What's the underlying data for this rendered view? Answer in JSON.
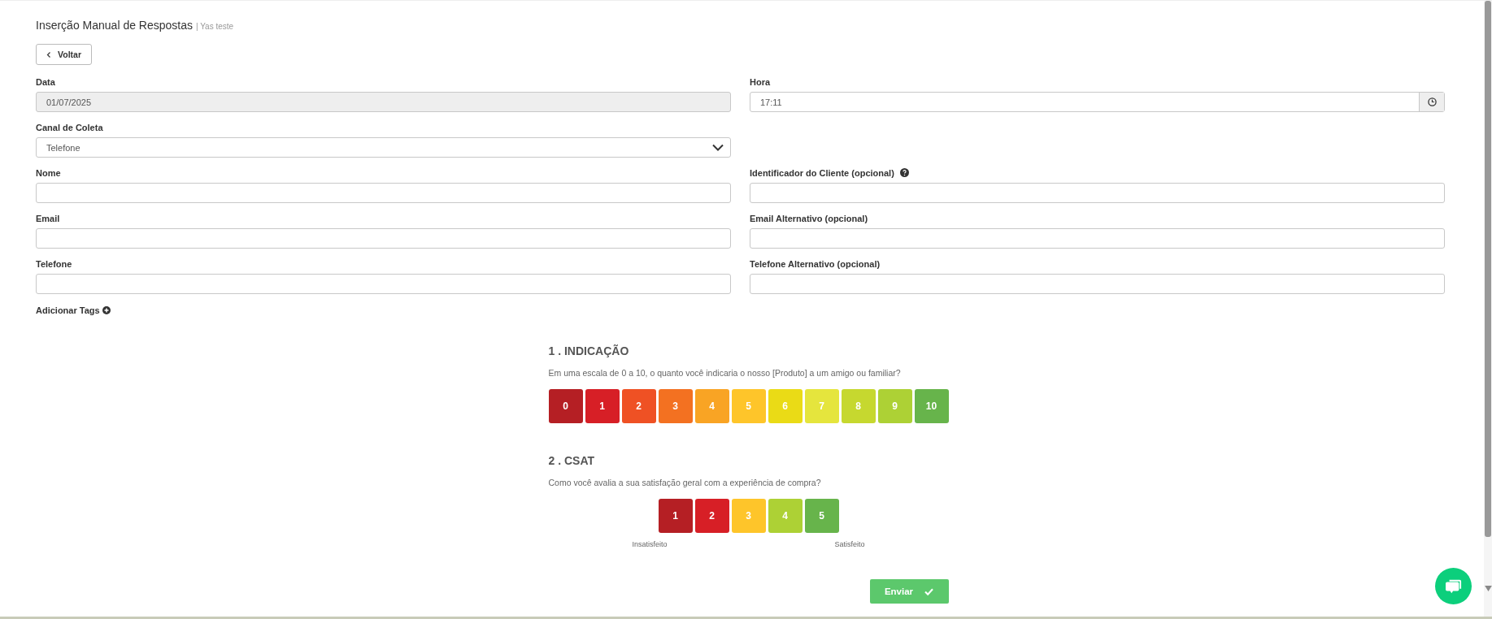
{
  "header": {
    "title": "Inserção Manual de Respostas",
    "subtitle": "| Yas teste"
  },
  "back_button": {
    "label": "Voltar"
  },
  "form_rows": [
    [
      {
        "kind": "text",
        "label": "Data",
        "value": "01/07/2025",
        "disabled": true
      },
      {
        "kind": "time",
        "label": "Hora",
        "value": "17:11"
      }
    ],
    [
      {
        "kind": "select",
        "label": "Canal de Coleta",
        "value": "Telefone"
      }
    ],
    [
      {
        "kind": "text",
        "label": "Nome"
      },
      {
        "kind": "text",
        "label": "Identificador do Cliente (opcional)",
        "help": true
      }
    ],
    [
      {
        "kind": "text",
        "label": "Email"
      },
      {
        "kind": "text",
        "label": "Email Alternativo (opcional)"
      }
    ],
    [
      {
        "kind": "text",
        "label": "Telefone"
      },
      {
        "kind": "text",
        "label": "Telefone Alternativo (opcional)"
      }
    ]
  ],
  "add_tags": {
    "label": "Adicionar Tags"
  },
  "questions": [
    {
      "kind": "nps",
      "title": "1 . INDICAÇÃO",
      "text": "Em uma escala de 0 a 10, o quanto você indicaria o nosso [Produto] a um amigo ou familiar?",
      "options": [
        {
          "label": "0",
          "color": "#b51f24"
        },
        {
          "label": "1",
          "color": "#d71f26"
        },
        {
          "label": "2",
          "color": "#ef5124"
        },
        {
          "label": "3",
          "color": "#f37121"
        },
        {
          "label": "4",
          "color": "#f9a424"
        },
        {
          "label": "5",
          "color": "#fec52a"
        },
        {
          "label": "6",
          "color": "#eadb16"
        },
        {
          "label": "7",
          "color": "#e5e53d"
        },
        {
          "label": "8",
          "color": "#c6d82f"
        },
        {
          "label": "9",
          "color": "#add135"
        },
        {
          "label": "10",
          "color": "#67b44b"
        }
      ]
    },
    {
      "kind": "csat",
      "title": "2 . CSAT",
      "text": "Como você avalia a sua satisfação geral com a experiência de compra?",
      "low_label": "Insatisfeito",
      "high_label": "Satisfeito",
      "options": [
        {
          "label": "1",
          "color": "#b51f24"
        },
        {
          "label": "2",
          "color": "#d71f26"
        },
        {
          "label": "3",
          "color": "#fec52a"
        },
        {
          "label": "4",
          "color": "#add135"
        },
        {
          "label": "5",
          "color": "#67b44b"
        }
      ]
    }
  ],
  "submit_button": {
    "label": "Enviar"
  }
}
